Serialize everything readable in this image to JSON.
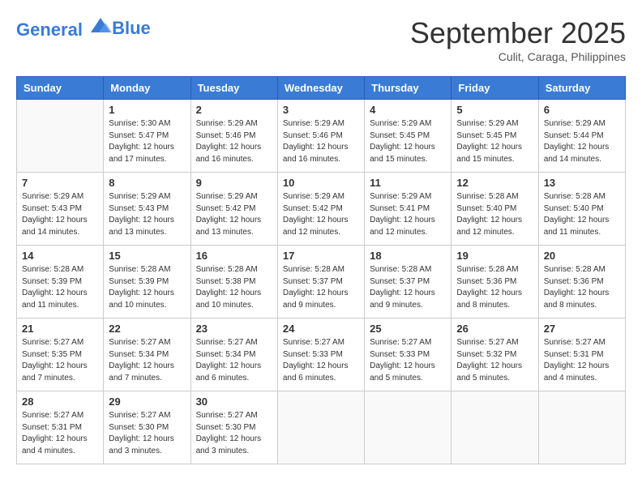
{
  "header": {
    "logo_line1": "General",
    "logo_line2": "Blue",
    "month": "September 2025",
    "location": "Culit, Caraga, Philippines"
  },
  "weekdays": [
    "Sunday",
    "Monday",
    "Tuesday",
    "Wednesday",
    "Thursday",
    "Friday",
    "Saturday"
  ],
  "weeks": [
    [
      {
        "day": "",
        "info": ""
      },
      {
        "day": "1",
        "info": "Sunrise: 5:30 AM\nSunset: 5:47 PM\nDaylight: 12 hours\nand 17 minutes."
      },
      {
        "day": "2",
        "info": "Sunrise: 5:29 AM\nSunset: 5:46 PM\nDaylight: 12 hours\nand 16 minutes."
      },
      {
        "day": "3",
        "info": "Sunrise: 5:29 AM\nSunset: 5:46 PM\nDaylight: 12 hours\nand 16 minutes."
      },
      {
        "day": "4",
        "info": "Sunrise: 5:29 AM\nSunset: 5:45 PM\nDaylight: 12 hours\nand 15 minutes."
      },
      {
        "day": "5",
        "info": "Sunrise: 5:29 AM\nSunset: 5:45 PM\nDaylight: 12 hours\nand 15 minutes."
      },
      {
        "day": "6",
        "info": "Sunrise: 5:29 AM\nSunset: 5:44 PM\nDaylight: 12 hours\nand 14 minutes."
      }
    ],
    [
      {
        "day": "7",
        "info": "Sunrise: 5:29 AM\nSunset: 5:43 PM\nDaylight: 12 hours\nand 14 minutes."
      },
      {
        "day": "8",
        "info": "Sunrise: 5:29 AM\nSunset: 5:43 PM\nDaylight: 12 hours\nand 13 minutes."
      },
      {
        "day": "9",
        "info": "Sunrise: 5:29 AM\nSunset: 5:42 PM\nDaylight: 12 hours\nand 13 minutes."
      },
      {
        "day": "10",
        "info": "Sunrise: 5:29 AM\nSunset: 5:42 PM\nDaylight: 12 hours\nand 12 minutes."
      },
      {
        "day": "11",
        "info": "Sunrise: 5:29 AM\nSunset: 5:41 PM\nDaylight: 12 hours\nand 12 minutes."
      },
      {
        "day": "12",
        "info": "Sunrise: 5:28 AM\nSunset: 5:40 PM\nDaylight: 12 hours\nand 12 minutes."
      },
      {
        "day": "13",
        "info": "Sunrise: 5:28 AM\nSunset: 5:40 PM\nDaylight: 12 hours\nand 11 minutes."
      }
    ],
    [
      {
        "day": "14",
        "info": "Sunrise: 5:28 AM\nSunset: 5:39 PM\nDaylight: 12 hours\nand 11 minutes."
      },
      {
        "day": "15",
        "info": "Sunrise: 5:28 AM\nSunset: 5:39 PM\nDaylight: 12 hours\nand 10 minutes."
      },
      {
        "day": "16",
        "info": "Sunrise: 5:28 AM\nSunset: 5:38 PM\nDaylight: 12 hours\nand 10 minutes."
      },
      {
        "day": "17",
        "info": "Sunrise: 5:28 AM\nSunset: 5:37 PM\nDaylight: 12 hours\nand 9 minutes."
      },
      {
        "day": "18",
        "info": "Sunrise: 5:28 AM\nSunset: 5:37 PM\nDaylight: 12 hours\nand 9 minutes."
      },
      {
        "day": "19",
        "info": "Sunrise: 5:28 AM\nSunset: 5:36 PM\nDaylight: 12 hours\nand 8 minutes."
      },
      {
        "day": "20",
        "info": "Sunrise: 5:28 AM\nSunset: 5:36 PM\nDaylight: 12 hours\nand 8 minutes."
      }
    ],
    [
      {
        "day": "21",
        "info": "Sunrise: 5:27 AM\nSunset: 5:35 PM\nDaylight: 12 hours\nand 7 minutes."
      },
      {
        "day": "22",
        "info": "Sunrise: 5:27 AM\nSunset: 5:34 PM\nDaylight: 12 hours\nand 7 minutes."
      },
      {
        "day": "23",
        "info": "Sunrise: 5:27 AM\nSunset: 5:34 PM\nDaylight: 12 hours\nand 6 minutes."
      },
      {
        "day": "24",
        "info": "Sunrise: 5:27 AM\nSunset: 5:33 PM\nDaylight: 12 hours\nand 6 minutes."
      },
      {
        "day": "25",
        "info": "Sunrise: 5:27 AM\nSunset: 5:33 PM\nDaylight: 12 hours\nand 5 minutes."
      },
      {
        "day": "26",
        "info": "Sunrise: 5:27 AM\nSunset: 5:32 PM\nDaylight: 12 hours\nand 5 minutes."
      },
      {
        "day": "27",
        "info": "Sunrise: 5:27 AM\nSunset: 5:31 PM\nDaylight: 12 hours\nand 4 minutes."
      }
    ],
    [
      {
        "day": "28",
        "info": "Sunrise: 5:27 AM\nSunset: 5:31 PM\nDaylight: 12 hours\nand 4 minutes."
      },
      {
        "day": "29",
        "info": "Sunrise: 5:27 AM\nSunset: 5:30 PM\nDaylight: 12 hours\nand 3 minutes."
      },
      {
        "day": "30",
        "info": "Sunrise: 5:27 AM\nSunset: 5:30 PM\nDaylight: 12 hours\nand 3 minutes."
      },
      {
        "day": "",
        "info": ""
      },
      {
        "day": "",
        "info": ""
      },
      {
        "day": "",
        "info": ""
      },
      {
        "day": "",
        "info": ""
      }
    ]
  ]
}
